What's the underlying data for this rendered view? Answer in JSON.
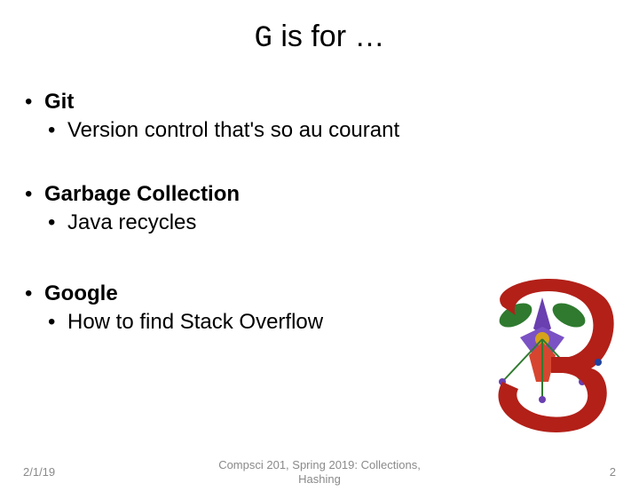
{
  "title": {
    "code": "G",
    "rest": " is for …"
  },
  "items": [
    {
      "heading": "Git",
      "sub": "Version control that's so au courant"
    },
    {
      "heading": "Garbage Collection",
      "sub": "Java recycles"
    },
    {
      "heading": "Google",
      "sub": "How to find Stack Overflow"
    }
  ],
  "footer": {
    "date": "2/1/19",
    "course_line1": "Compsci 201, Spring 2019: Collections,",
    "course_line2": "Hashing",
    "page": "2"
  }
}
